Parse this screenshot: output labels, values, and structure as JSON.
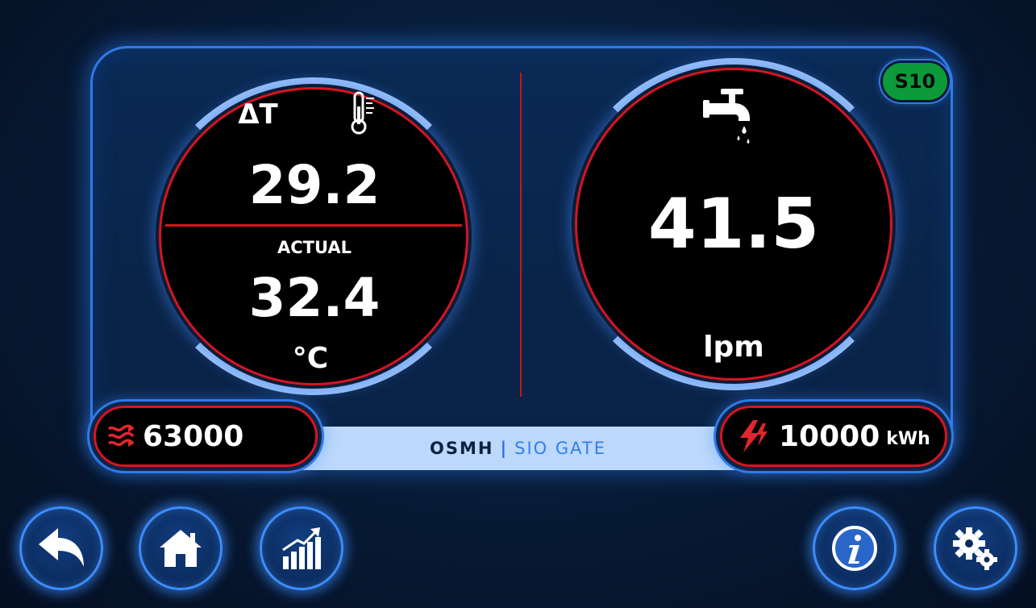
{
  "temperature_panel": {
    "delta_symbol": "ΔT",
    "delta_value": "29.2",
    "actual_label": "ACTUAL",
    "actual_value": "32.4",
    "unit": "°C",
    "icon": "thermometer-icon"
  },
  "flow_panel": {
    "value": "41.5",
    "unit": "lpm",
    "icon": "water-tap-icon"
  },
  "status_badge": {
    "label": "S10",
    "color": "#0c9a3a"
  },
  "heat_counter": {
    "value": "63000",
    "icon": "heat-waves-icon"
  },
  "energy_counter": {
    "value": "10000",
    "unit": "kWh",
    "icon": "lightning-icon"
  },
  "brand": {
    "primary": "OSMH",
    "separator": "|",
    "secondary": "SIO GATE"
  },
  "nav_buttons": [
    {
      "icon": "back-arrow-icon"
    },
    {
      "icon": "home-icon"
    },
    {
      "icon": "chart-icon"
    },
    {
      "icon": "info-icon"
    },
    {
      "icon": "settings-icon"
    }
  ],
  "colors": {
    "accent": "#2f7ae8",
    "ring": "#d8141f",
    "bar": "#bcd8fb"
  }
}
